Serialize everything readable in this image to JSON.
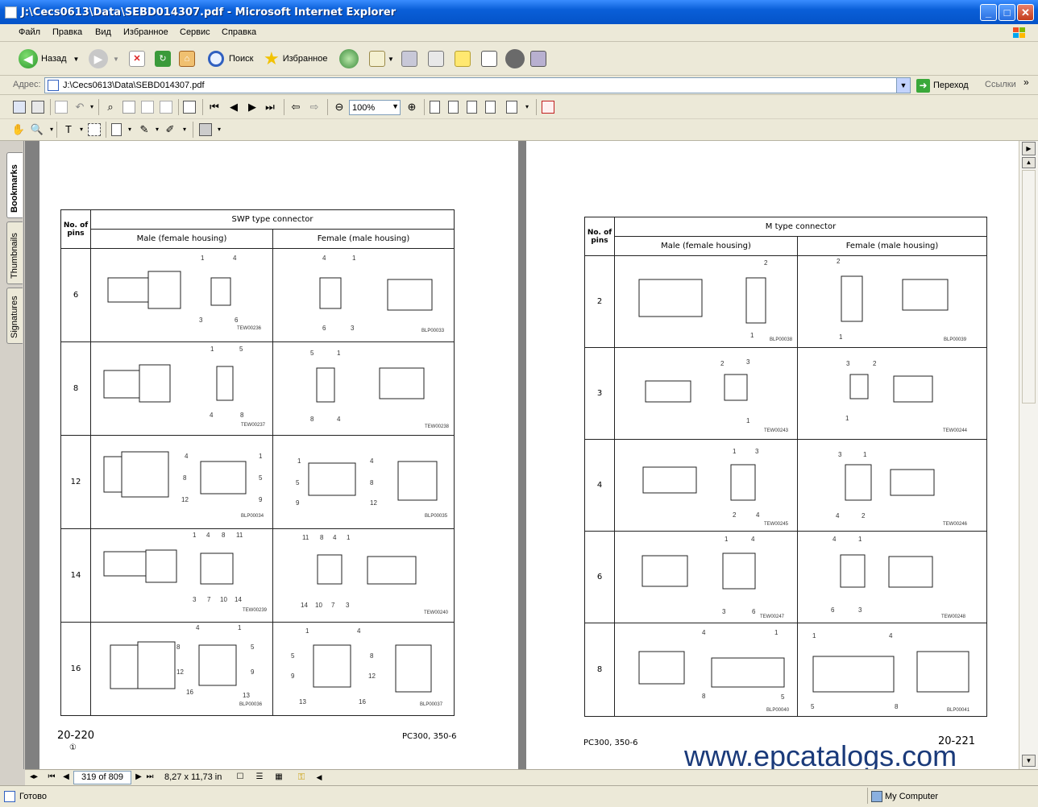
{
  "window": {
    "title": "J:\\Cecs0613\\Data\\SEBD014307.pdf - Microsoft Internet Explorer",
    "minimize": "_",
    "maximize": "□",
    "close": "✕"
  },
  "menu": [
    "Файл",
    "Правка",
    "Вид",
    "Избранное",
    "Сервис",
    "Справка"
  ],
  "toolbar": {
    "back": "Назад",
    "search": "Поиск",
    "favorites": "Избранное"
  },
  "address": {
    "label": "Адрес:",
    "value": "J:\\Cecs0613\\Data\\SEBD014307.pdf",
    "go": "Переход",
    "links": "Ссылки",
    "more": "»"
  },
  "acrobat": {
    "zoom": "100%"
  },
  "nav_tabs": [
    "Bookmarks",
    "Thumbnails",
    "Signatures"
  ],
  "left_page": {
    "header_no": "No. of pins",
    "title": "SWP type connector",
    "col_male": "Male (female housing)",
    "col_female": "Female (male housing)",
    "rows": [
      {
        "pins": "6",
        "male_code": "TEW00236",
        "female_code": "BLP00033",
        "male_labels": [
          "1",
          "4",
          "3",
          "6"
        ],
        "female_labels": [
          "4",
          "1",
          "6",
          "3"
        ]
      },
      {
        "pins": "8",
        "male_code": "TEW00237",
        "female_code": "TEW00238",
        "male_labels": [
          "1",
          "5",
          "4",
          "8"
        ],
        "female_labels": [
          "5",
          "1",
          "8",
          "4"
        ]
      },
      {
        "pins": "12",
        "male_code": "BLP00034",
        "female_code": "BLP00035",
        "male_labels": [
          "4",
          "1",
          "8",
          "5",
          "12",
          "9"
        ],
        "female_labels": [
          "1",
          "4",
          "5",
          "8",
          "9",
          "12"
        ]
      },
      {
        "pins": "14",
        "male_code": "TEW00239",
        "female_code": "TEW00240",
        "male_labels": [
          "1",
          "4",
          "8",
          "11",
          "3",
          "7",
          "10",
          "14"
        ],
        "female_labels": [
          "11",
          "8",
          "4",
          "1",
          "14",
          "10",
          "7",
          "3"
        ]
      },
      {
        "pins": "16",
        "male_code": "BLP00036",
        "female_code": "BLP00037",
        "male_labels": [
          "4",
          "1",
          "8",
          "5",
          "12",
          "9",
          "16",
          "13"
        ],
        "female_labels": [
          "1",
          "4",
          "5",
          "8",
          "9",
          "12",
          "13",
          "16"
        ]
      }
    ],
    "page_number": "20-220",
    "revision": "①",
    "model": "PC300, 350-6"
  },
  "right_page": {
    "header_no": "No. of pins",
    "title": "M type connector",
    "col_male": "Male (female housing)",
    "col_female": "Female (male housing)",
    "rows": [
      {
        "pins": "2",
        "male_code": "BLP00038",
        "female_code": "BLP00039",
        "male_labels": [
          "2",
          "1"
        ],
        "female_labels": [
          "2",
          "1"
        ]
      },
      {
        "pins": "3",
        "male_code": "TEW00243",
        "female_code": "TEW00244",
        "male_labels": [
          "2",
          "3",
          "1"
        ],
        "female_labels": [
          "3",
          "2",
          "1"
        ]
      },
      {
        "pins": "4",
        "male_code": "TEW00245",
        "female_code": "TEW00246",
        "male_labels": [
          "1",
          "3",
          "2",
          "4"
        ],
        "female_labels": [
          "3",
          "1",
          "4",
          "2"
        ]
      },
      {
        "pins": "6",
        "male_code": "TEW00247",
        "female_code": "TEW00248",
        "male_labels": [
          "1",
          "4",
          "3",
          "6"
        ],
        "female_labels": [
          "4",
          "1",
          "6",
          "3"
        ]
      },
      {
        "pins": "8",
        "male_code": "BLP00040",
        "female_code": "BLP00041",
        "male_labels": [
          "4",
          "1",
          "8",
          "5"
        ],
        "female_labels": [
          "1",
          "4",
          "5",
          "8"
        ]
      }
    ],
    "page_number": "20-221",
    "model": "PC300, 350-6"
  },
  "watermark": "www.epcatalogs.com",
  "acrobat_status": {
    "page": "319 of 809",
    "size": "8,27 x 11,73 in"
  },
  "status": {
    "text": "Готово",
    "zone": "My Computer"
  }
}
